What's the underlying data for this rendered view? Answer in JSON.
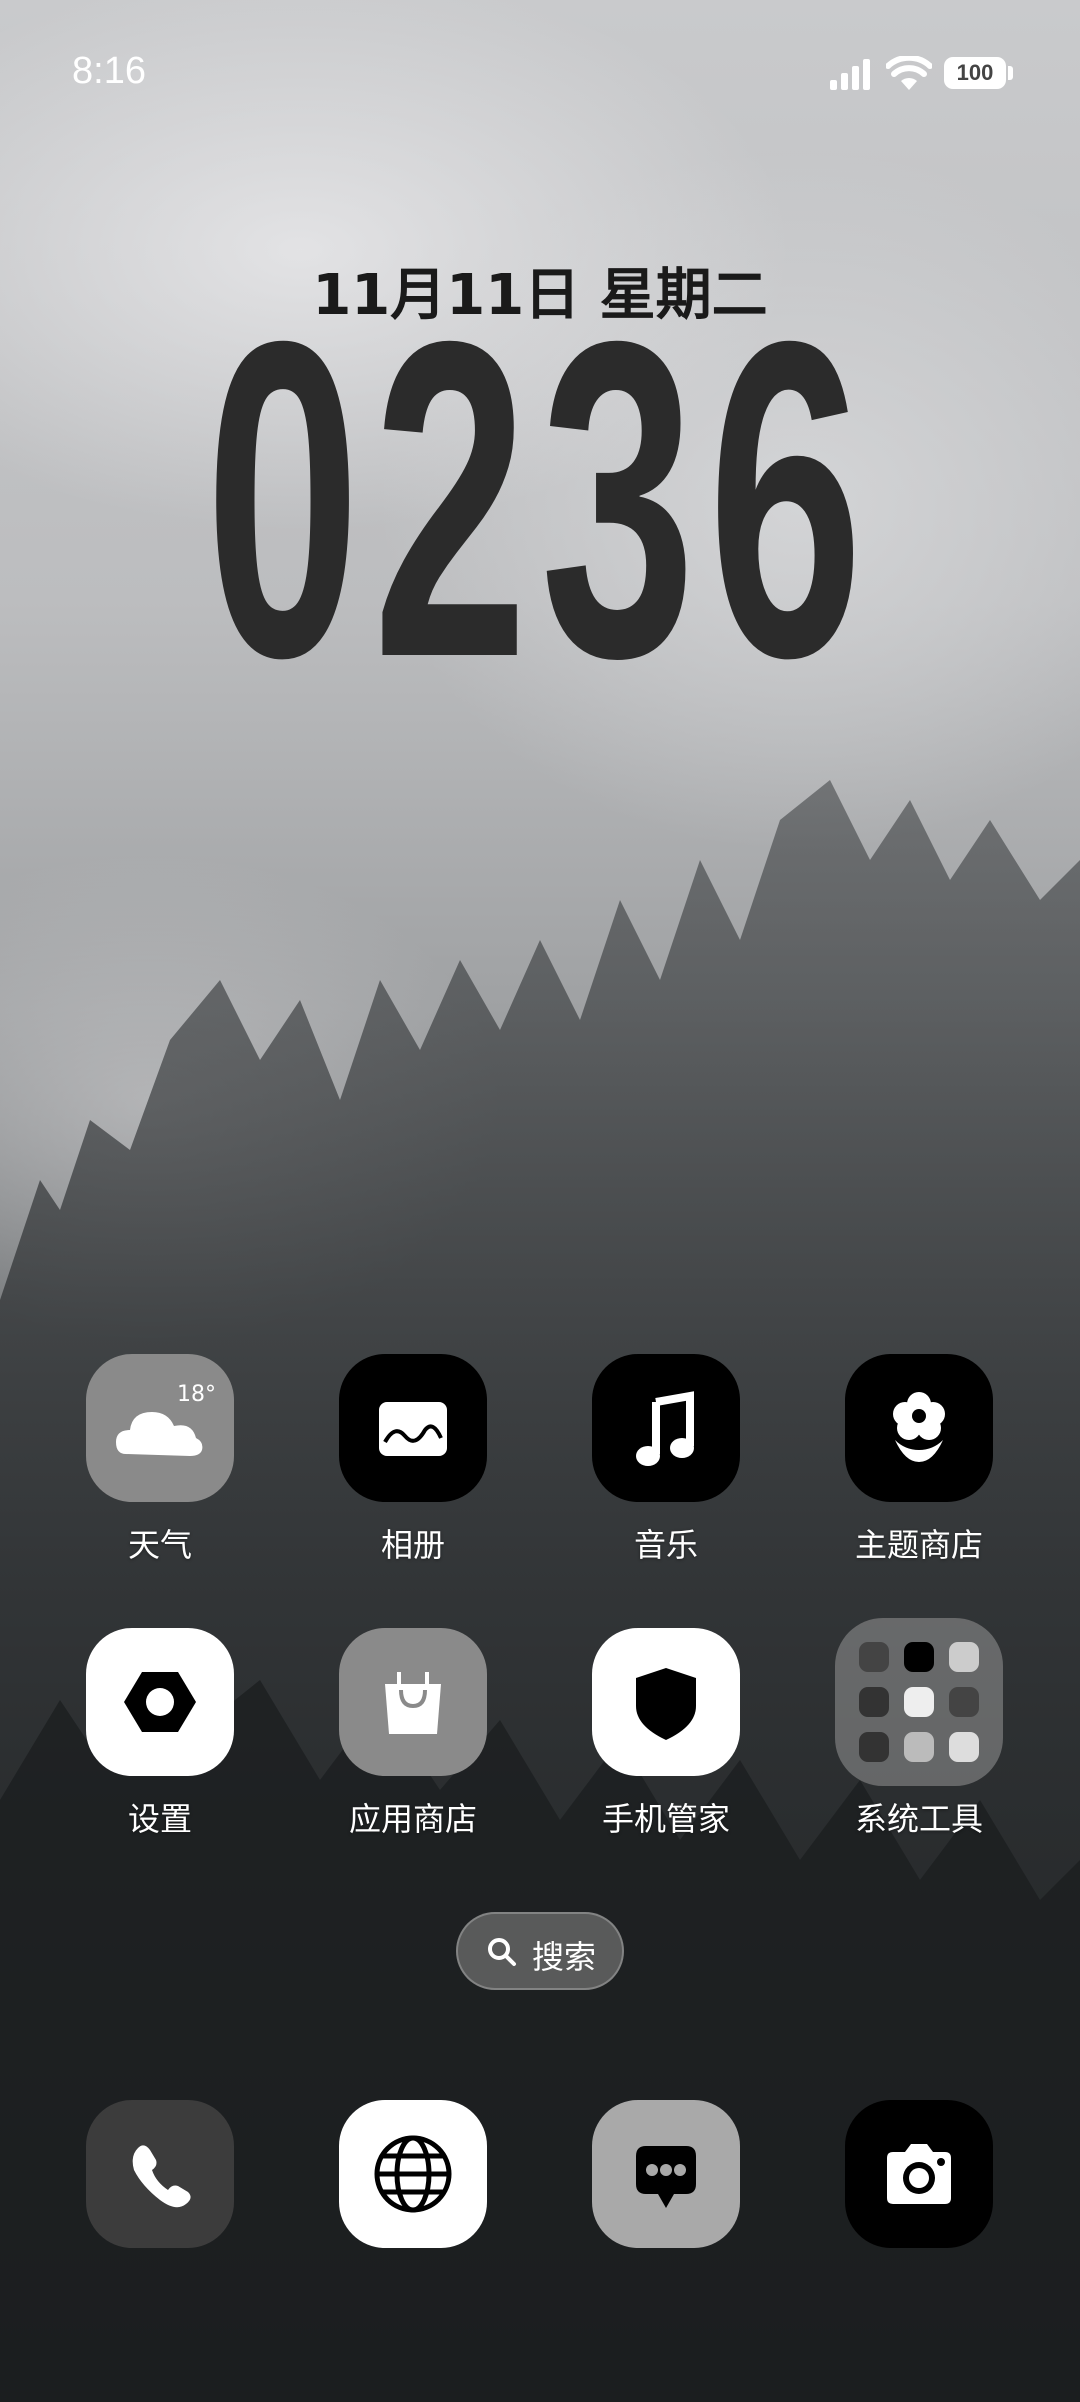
{
  "status_bar": {
    "time": "8:16",
    "battery": "100"
  },
  "lockscreen": {
    "date": "11月11日 星期二",
    "clock": "0236"
  },
  "weather": {
    "temp": "18°"
  },
  "apps_row1": [
    {
      "label": "天气",
      "icon": "weather-cloud-icon"
    },
    {
      "label": "相册",
      "icon": "gallery-icon"
    },
    {
      "label": "音乐",
      "icon": "music-note-icon"
    },
    {
      "label": "主题商店",
      "icon": "flower-icon"
    }
  ],
  "apps_row2": [
    {
      "label": "设置",
      "icon": "hex-nut-icon"
    },
    {
      "label": "应用商店",
      "icon": "shopping-bag-icon"
    },
    {
      "label": "手机管家",
      "icon": "shield-icon"
    },
    {
      "label": "系统工具",
      "icon": "folder-icon"
    }
  ],
  "search": {
    "label": "搜索"
  },
  "dock": [
    {
      "icon": "phone-icon"
    },
    {
      "icon": "browser-globe-icon"
    },
    {
      "icon": "messages-icon"
    },
    {
      "icon": "camera-icon"
    }
  ]
}
